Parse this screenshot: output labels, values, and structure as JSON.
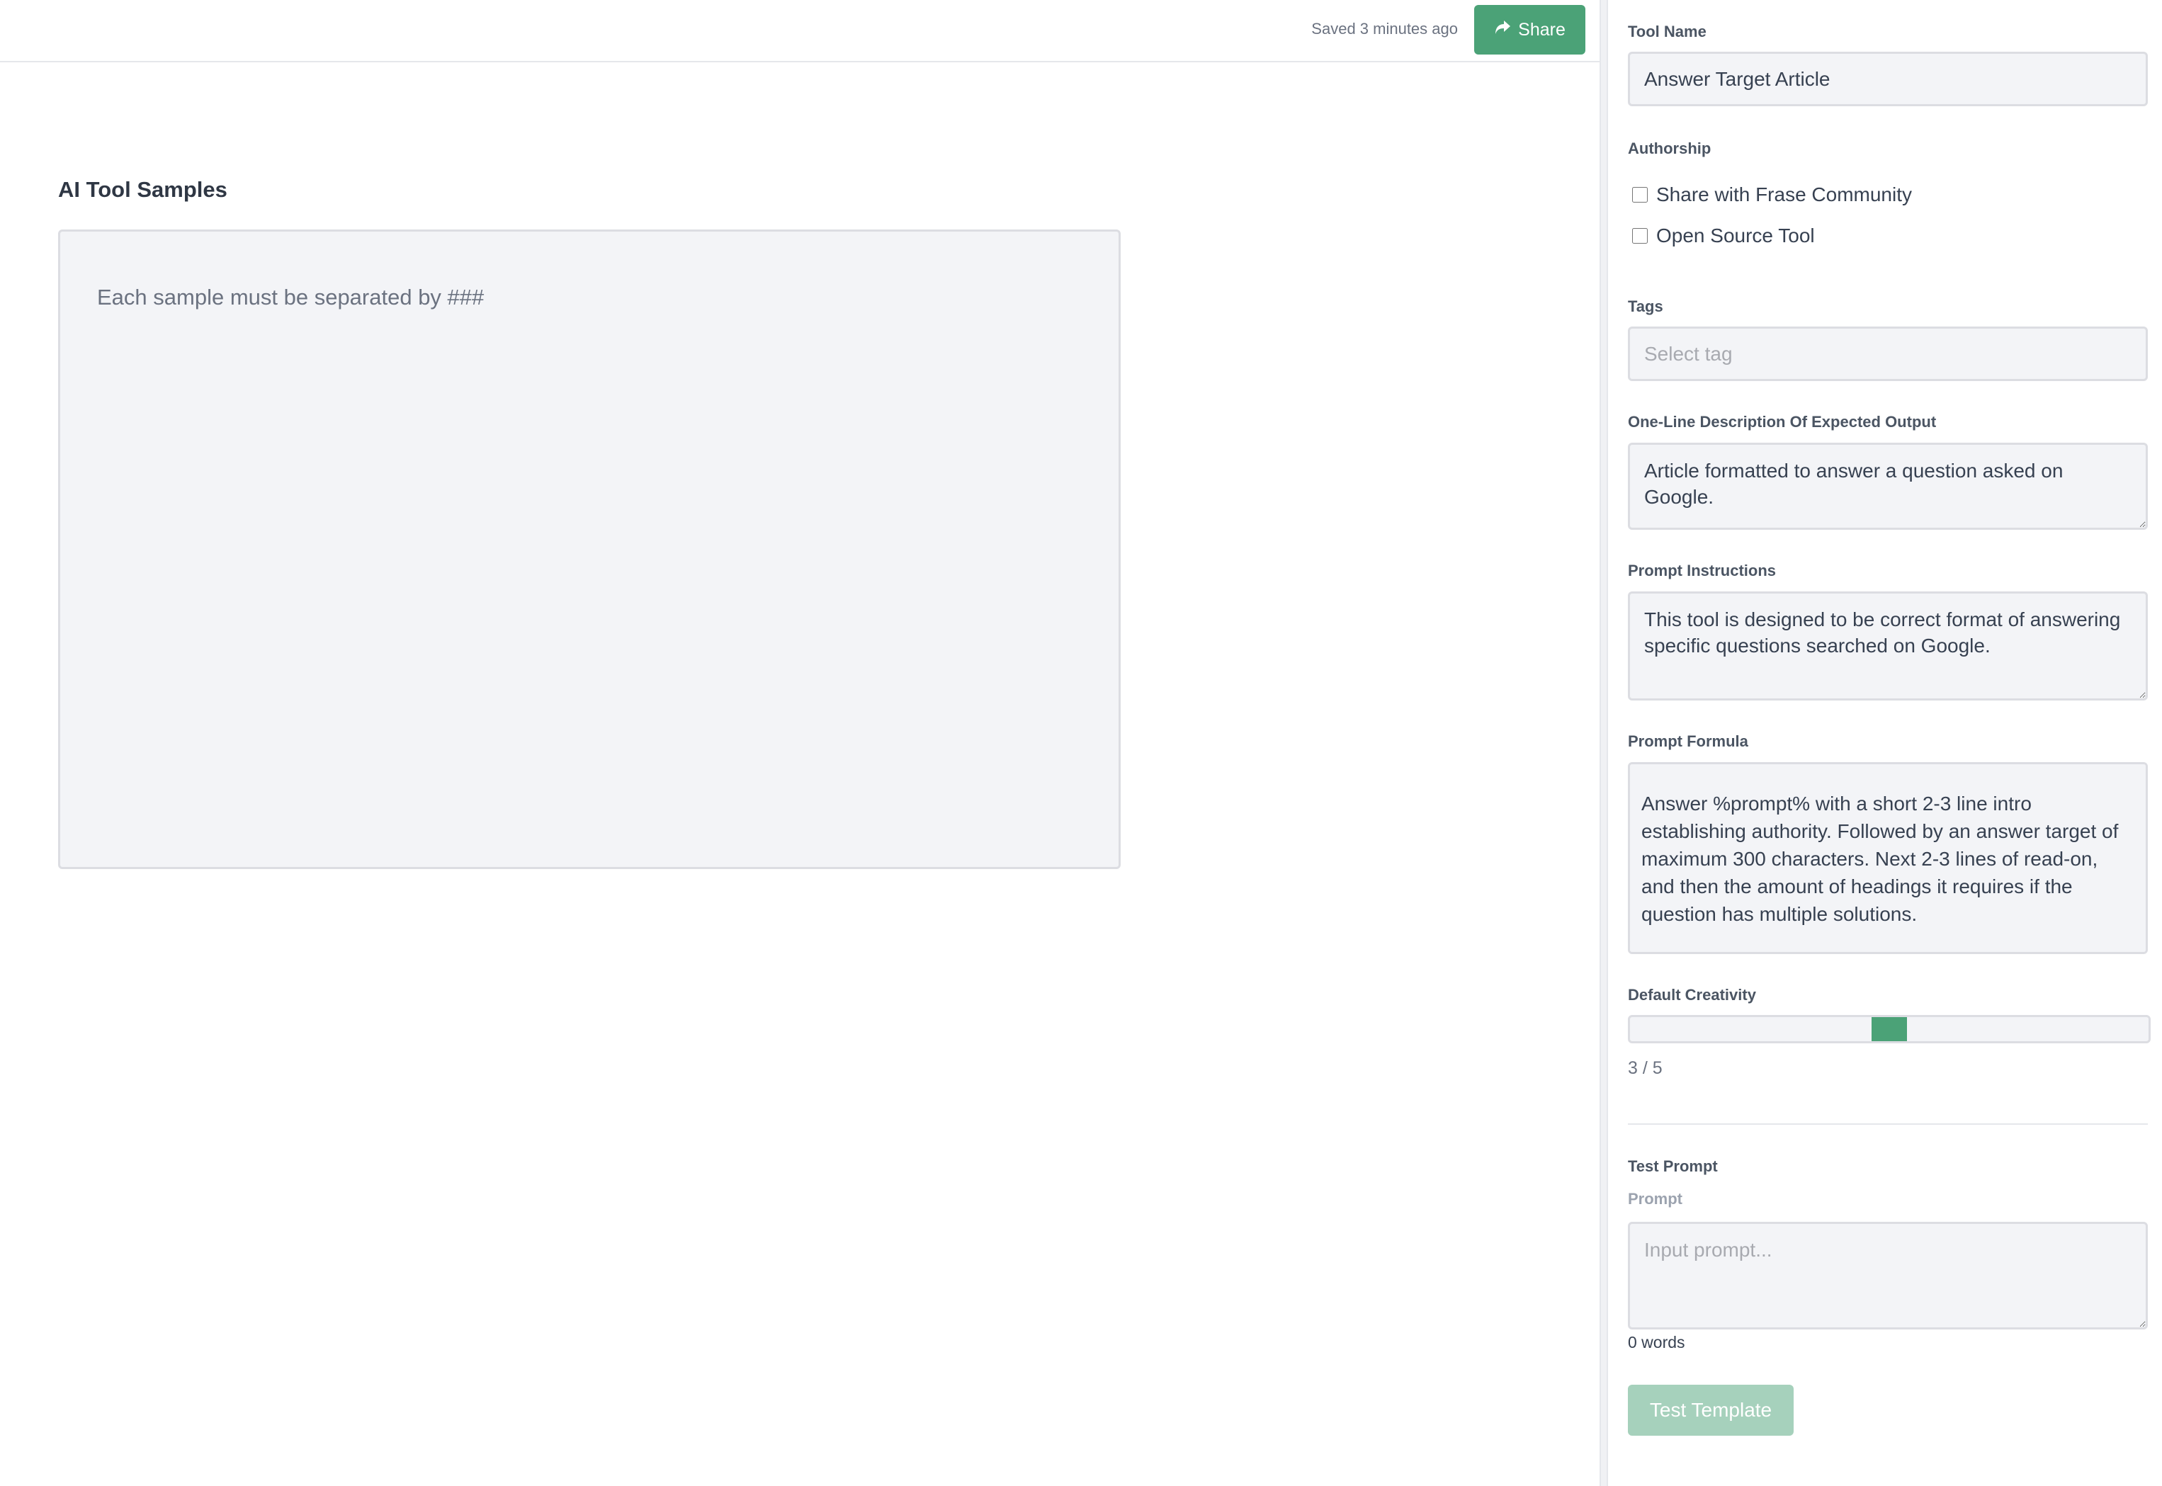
{
  "header": {
    "save_status": "Saved 3 minutes ago",
    "share_label": "Share",
    "share_icon": "share-arrow-icon",
    "accent_color": "#4ba277"
  },
  "samples": {
    "title": "AI Tool Samples",
    "placeholder": "Each sample must be separated by ###",
    "value": ""
  },
  "panel": {
    "tool_name": {
      "label": "Tool Name",
      "value": "Answer Target Article"
    },
    "authorship": {
      "label": "Authorship",
      "options": [
        {
          "label": "Share with Frase Community",
          "checked": false
        },
        {
          "label": "Open Source Tool",
          "checked": false
        }
      ]
    },
    "tags": {
      "label": "Tags",
      "placeholder": "Select tag"
    },
    "description": {
      "label": "One-Line Description Of Expected Output",
      "value": "Article formatted to answer a question asked on Google."
    },
    "instructions": {
      "label": "Prompt Instructions",
      "value": "This tool is designed to be correct format of answering specific questions searched on Google."
    },
    "formula": {
      "label": "Prompt Formula",
      "value": "Answer %prompt% with a short 2-3 line intro establishing authority. Followed by an answer target of maximum 300 characters. Next 2-3 lines of read-on, and then the amount of headings it requires if the question has multiple solutions."
    },
    "creativity": {
      "label": "Default Creativity",
      "value": 3,
      "max": 5,
      "display": "3 / 5"
    },
    "test_prompt": {
      "section_label": "Test Prompt",
      "prompt_label": "Prompt",
      "placeholder": "Input prompt...",
      "value": "",
      "word_count": "0 words",
      "button_label": "Test Template"
    }
  }
}
